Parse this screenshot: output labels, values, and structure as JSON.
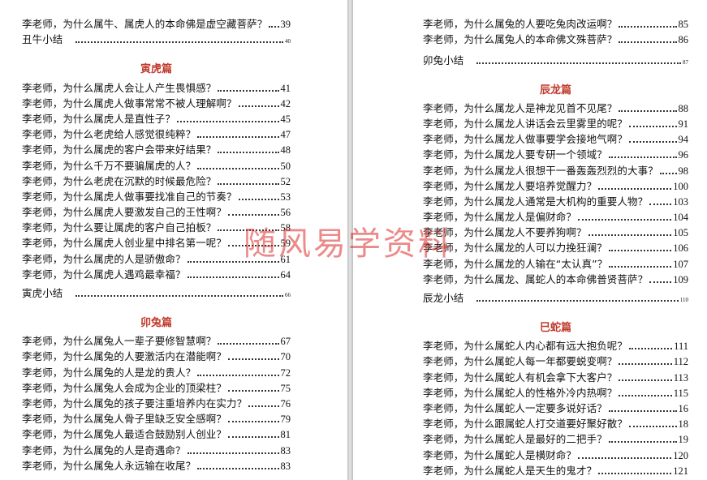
{
  "watermark": "随风易学资料",
  "left_page": {
    "rows_top": [
      {
        "title": "李老师，为什么属牛、属虎人的本命佛是虚空藏菩萨？",
        "page": "39"
      }
    ],
    "summary_top": {
      "title": "丑牛小结",
      "page": "40"
    },
    "sections": [
      {
        "heading": "寅虎篇",
        "rows": [
          {
            "title": "李老师，为什么属虎人会让人产生畏惧感？",
            "page": "41"
          },
          {
            "title": "李老师，为什么属虎人做事常常不被人理解啊？",
            "page": "42"
          },
          {
            "title": "李老师，为什么属虎人是直性子？",
            "page": "45"
          },
          {
            "title": "李老师，为什么老虎给人感觉很纯粹？",
            "page": "47"
          },
          {
            "title": "李老师，为什么属虎的客户会带来好结果？",
            "page": "48"
          },
          {
            "title": "李老师，为什么千万不要骗属虎的人？",
            "page": "50"
          },
          {
            "title": "李老师，为什么老虎在沉默的时候最危险？",
            "page": "52"
          },
          {
            "title": "李老师，为什么属虎人做事要找准自己的节奏？",
            "page": "53"
          },
          {
            "title": "李老师，为什么属虎人要激发自己的王性啊？",
            "page": "56"
          },
          {
            "title": "李老师，为什么要让属虎的客户自己拍板？",
            "page": "58"
          },
          {
            "title": "李老师，为什么属虎人创业星中排名第一呢？",
            "page": "59"
          },
          {
            "title": "李老师，为什么属虎的人是骄傲命？",
            "page": "61"
          },
          {
            "title": "李老师，为什么属虎人遇鸡最幸福？",
            "page": "64"
          }
        ],
        "summary": {
          "title": "寅虎小结",
          "page": "66"
        }
      },
      {
        "heading": "卯兔篇",
        "rows": [
          {
            "title": "李老师，为什么属兔人一辈子要修智慧啊？",
            "page": "67"
          },
          {
            "title": "李老师，为什么属兔的人要激活内在潜能啊？",
            "page": "70"
          },
          {
            "title": "李老师，为什么属兔的人是龙的贵人？",
            "page": "72"
          },
          {
            "title": "李老师，为什么属兔人会成为企业的顶梁柱？",
            "page": "75"
          },
          {
            "title": "李老师，为什么属兔的孩子要注重培养内在实力？",
            "page": "76"
          },
          {
            "title": "李老师，为什么属兔人骨子里缺乏安全感啊？",
            "page": "79"
          },
          {
            "title": "李老师，为什么属兔人最适合鼓励别人创业？",
            "page": "81"
          },
          {
            "title": "李老师，为什么属兔的人是奇遇命？",
            "page": "83"
          },
          {
            "title": "李老师，为什么属兔人永远输在收尾？",
            "page": "83"
          }
        ]
      }
    ]
  },
  "right_page": {
    "rows_top": [
      {
        "title": "李老师，为什么属兔的人要吃兔肉改运啊？",
        "page": "85"
      },
      {
        "title": "李老师，为什么属兔人的本命佛文殊菩萨？",
        "page": "86"
      }
    ],
    "summary_top": {
      "title": "卯兔小结",
      "page": "87"
    },
    "sections": [
      {
        "heading": "辰龙篇",
        "rows": [
          {
            "title": "李老师，为什么属龙人是神龙见首不见尾？",
            "page": "88"
          },
          {
            "title": "李老师，为什么属龙人讲话会云里雾里的呢？",
            "page": "91"
          },
          {
            "title": "李老师，为什么属龙人做事要学会接地气啊？",
            "page": "94"
          },
          {
            "title": "李老师，为什么属龙人要专研一个领域？",
            "page": "96"
          },
          {
            "title": "李老师，为什么属龙人很想干一番轰轰烈烈的大事？",
            "page": "98"
          },
          {
            "title": "李老师，为什么属龙人要培养觉醒力？",
            "page": "100"
          },
          {
            "title": "李老师，为什么属龙人通常是大机构的重要人物？",
            "page": "103"
          },
          {
            "title": "李老师，为什么属龙人是偏财命？",
            "page": "104"
          },
          {
            "title": "李老师，为什么属龙人不要养狗啊？",
            "page": "105"
          },
          {
            "title": "李老师，为什么属龙的人可以力挽狂澜？",
            "page": "106"
          },
          {
            "title": "李老师，为什么属龙的人输在“太认真”？",
            "page": "107"
          },
          {
            "title": "李老师，为什么属龙、属蛇人的本命佛普贤菩萨？",
            "page": "109"
          }
        ],
        "summary": {
          "title": "辰龙小结",
          "page": "110"
        }
      },
      {
        "heading": "巳蛇篇",
        "rows": [
          {
            "title": "李老师，为什么属蛇人内心都有远大抱负呢？",
            "page": "111"
          },
          {
            "title": "李老师，为什么属蛇人每一年都要蜕变啊？",
            "page": "112"
          },
          {
            "title": "李老师，为什么属蛇人有机会拿下大客户？",
            "page": "113"
          },
          {
            "title": "李老师，为什么属蛇人的性格外冷内热啊？",
            "page": "115"
          },
          {
            "title": "李老师，为什么属蛇人一定要多说好话？",
            "page": "16"
          },
          {
            "title": "李老师，为什么跟属蛇人打交道要好聚好散？",
            "page": "18"
          },
          {
            "title": "李老师，为什么属蛇人是最好的二把手？",
            "page": "19"
          },
          {
            "title": "李老师，为什么属蛇人是横财命？",
            "page": "120"
          },
          {
            "title": "李老师，为什么属蛇人是天生的鬼才？",
            "page": "121"
          }
        ]
      }
    ]
  }
}
